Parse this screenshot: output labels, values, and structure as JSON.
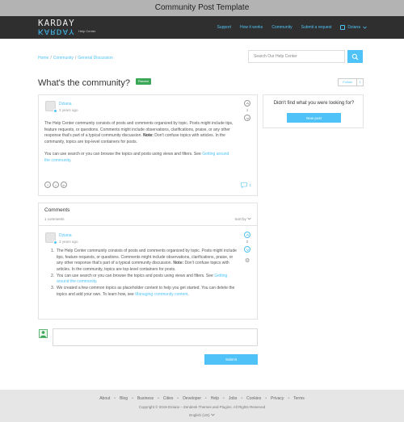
{
  "window": {
    "title": "Community Post Template"
  },
  "brand": {
    "logo": "KARDAY",
    "sub": "Help Center"
  },
  "nav": {
    "links": [
      "Support",
      "How it works",
      "Community",
      "Submit a request"
    ],
    "user": "Dziana"
  },
  "breadcrumb": [
    "Home",
    "Community",
    "General Discussion"
  ],
  "search": {
    "placeholder": "Search Our Help Center"
  },
  "post": {
    "title": "What's the community?",
    "badge": "Planned",
    "follow": "Follow",
    "follow_count": "1",
    "author": "Dziana",
    "time": "3 years ago",
    "votes": "1",
    "para1_a": "The Help Center community consists of posts and comments organized by topic. Posts might include tips, feature requests, or questions. Comments might include observations, clarifications, praise, or any other response that's part of a typical community discussion. ",
    "para1_note": "Note:",
    "para1_b": " Don't confuse topics with articles. In the community, topics are top-level containers for posts.",
    "para2_a": "You can use search or you can browse the topics and posts using views and filters. See ",
    "para2_link": "Getting around the community",
    "para2_b": ".",
    "share": [
      "f",
      "t",
      "in"
    ],
    "comment_count": "1"
  },
  "sidebar": {
    "question": "Didn't find what you were looking for?",
    "new_post": "New post"
  },
  "comments": {
    "title": "Comments",
    "count_label": "1 comments",
    "sort": "Sort by",
    "author": "Dziana",
    "time": "3 years ago",
    "votes": "0",
    "items": [
      {
        "num": "1.",
        "a": "The Help Center community consists of posts and comments organized by topic. Posts might include tips, feature requests, or questions. Comments might include observations, clarifications, praise, or any other response that's part of a typical community discussion. ",
        "note": "Note:",
        "b": " Don't confuse topics with articles. In the community, topics are top-level containers for posts."
      },
      {
        "num": "2.",
        "a": "You can use search or you can browse the topics and posts using views and filters. See ",
        "link": "Getting around the community",
        "b": "."
      },
      {
        "num": "3.",
        "a": "We created a few common topics as placeholder content to help you get started. You can delete the topics and add your own. To learn how, see ",
        "link": "Managing community content",
        "b": "."
      }
    ]
  },
  "reply": {
    "submit": "Submit"
  },
  "footer": {
    "links": [
      "About",
      "Blog",
      "Business",
      "Cities",
      "Developer",
      "Help",
      "Jobs",
      "Cookies",
      "Privacy",
      "Terms"
    ],
    "copyright": "Copyright © 2019 Dziana – Zendesk Themes and Plugins. All Rights Reserved",
    "language": "English (US)"
  },
  "colors": {
    "accent": "#4fc3f7",
    "navbar": "#2f2f2f",
    "badge": "#3aa757",
    "footer": "#e6e6e6"
  }
}
